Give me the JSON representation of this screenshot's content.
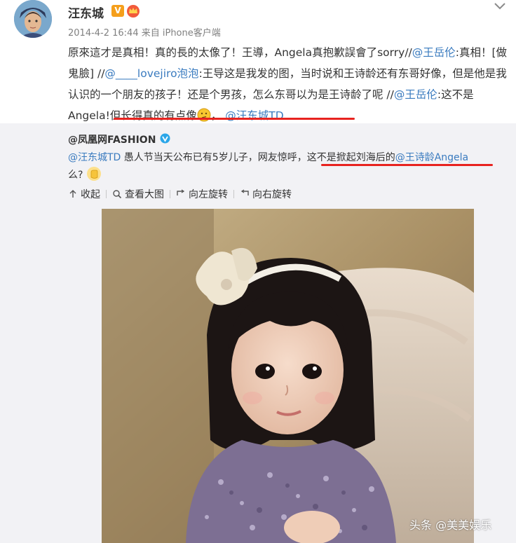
{
  "header": {
    "username": "汪东城",
    "verified_badge": "V",
    "meta": "2014-4-2 16:44 来自 iPhone客户端"
  },
  "post": {
    "t1": "原來這才是真相！真的長的太像了！王導，Angela真抱歉誤會了sorry//",
    "m1": "@王岳伦",
    "t2": ":真相！[做鬼臉] //",
    "m2": "@____lovejiro泡泡",
    "t3": ":王导这是我发的图，当时说和王诗龄还有东哥好像，但是他是我认识的一个朋友的孩子！还是个男孩，怎么东哥以为是王诗龄了呢 //",
    "m3": "@王岳伦",
    "t4": ":这不是Angela!但长得真的有点像",
    "t5": "，",
    "m4": "@汪东城TD"
  },
  "repost": {
    "author": "@凤凰网FASHION",
    "m1": "@汪东城TD",
    "t1": " 愚人节当天公布已有5岁儿子，网友惊呼，",
    "t2": "这不是掀起刘海后的",
    "m2": "@王诗龄Angela",
    "t3": "么?",
    "actions": [
      {
        "icon": "collapse-icon",
        "label": "收起"
      },
      {
        "icon": "magnifier-icon",
        "label": "查看大图"
      },
      {
        "icon": "rotate-left-icon",
        "label": "向左旋转"
      },
      {
        "icon": "rotate-right-icon",
        "label": "向右旋转"
      }
    ]
  },
  "watermark": "头条 @美美娱乐",
  "colors": {
    "link": "#3a7bbf",
    "highlight_line": "#e8231f",
    "repost_bg": "#f2f2f5",
    "badge": "#f59f1b"
  }
}
